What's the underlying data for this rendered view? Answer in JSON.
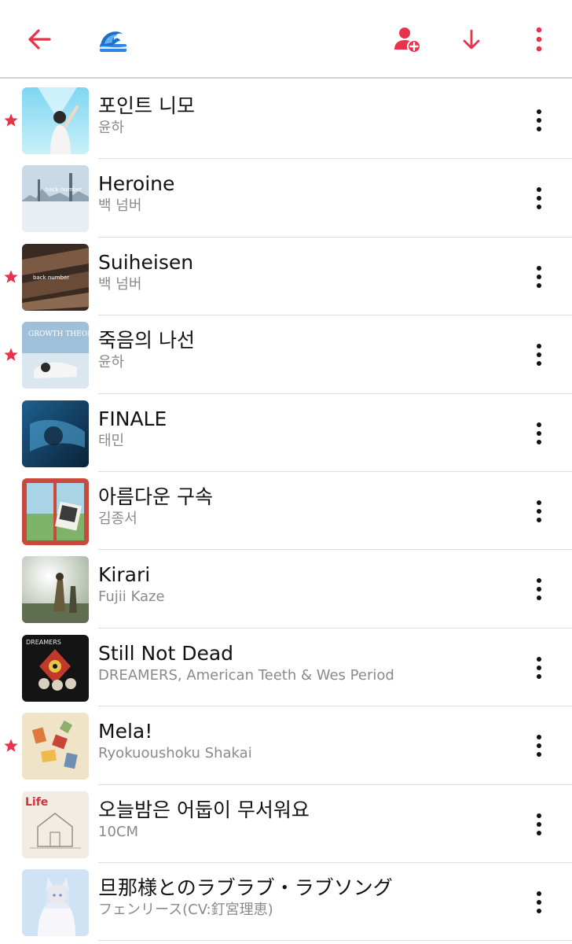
{
  "colors": {
    "accent": "#e8334a",
    "title_text": "#111111",
    "subtitle_text": "#8a8a8a",
    "divider": "#dedede"
  },
  "header": {
    "back_icon": "arrow-left-icon",
    "playlist_icon": "wave-emoji-icon",
    "playlist_glyph": "🌊",
    "add_person_icon": "person-add-icon",
    "download_icon": "arrow-down-icon",
    "more_icon": "more-vertical-icon"
  },
  "tracks": [
    {
      "title": "포인트 니모",
      "artist": "윤하",
      "starred": true,
      "art": "art-1"
    },
    {
      "title": "Heroine",
      "artist": "백 넘버",
      "starred": false,
      "art": "art-2"
    },
    {
      "title": "Suiheisen",
      "artist": "백 넘버",
      "starred": true,
      "art": "art-3"
    },
    {
      "title": "죽음의 나선",
      "artist": "윤하",
      "starred": true,
      "art": "art-4"
    },
    {
      "title": "FINALE",
      "artist": "태민",
      "starred": false,
      "art": "art-5"
    },
    {
      "title": "아름다운 구속",
      "artist": "김종서",
      "starred": false,
      "art": "art-6"
    },
    {
      "title": "Kirari",
      "artist": "Fujii Kaze",
      "starred": false,
      "art": "art-7"
    },
    {
      "title": "Still Not Dead",
      "artist": "DREAMERS, American Teeth & Wes Period",
      "starred": false,
      "art": "art-8"
    },
    {
      "title": "Mela!",
      "artist": "Ryokuoushoku Shakai",
      "starred": true,
      "art": "art-9"
    },
    {
      "title": "오늘밤은 어둡이 무서워요",
      "artist": "10CM",
      "starred": false,
      "art": "art-10"
    },
    {
      "title": "旦那様とのラブラブ・ラブソング",
      "artist": "フェンリース(CV:釘宮理恵)",
      "starred": false,
      "art": "art-11"
    }
  ],
  "artwork_text": {
    "art_2": "back number",
    "art_3": "back number",
    "art_4": "GROWTH THEORY",
    "art_8": "DREAMERS",
    "art_10": "Life"
  }
}
